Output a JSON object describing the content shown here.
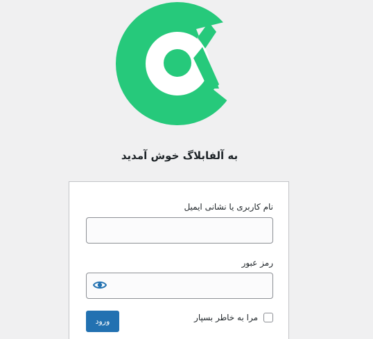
{
  "header": {
    "welcome_text": "به آلفابلاگ خوش آمدید"
  },
  "form": {
    "username_label": "نام کاربری یا نشانی ایمیل",
    "username_value": "",
    "password_label": "رمز عبور",
    "password_value": "",
    "remember_label": "مرا به خاطر بسپار",
    "remember_checked": false,
    "submit_label": "ورود"
  },
  "colors": {
    "brand_green": "#26c97b",
    "primary_button": "#2271b1",
    "background": "#f0f0f1"
  },
  "icons": {
    "logo": "alfablog-logo",
    "password_toggle": "eye-icon"
  }
}
